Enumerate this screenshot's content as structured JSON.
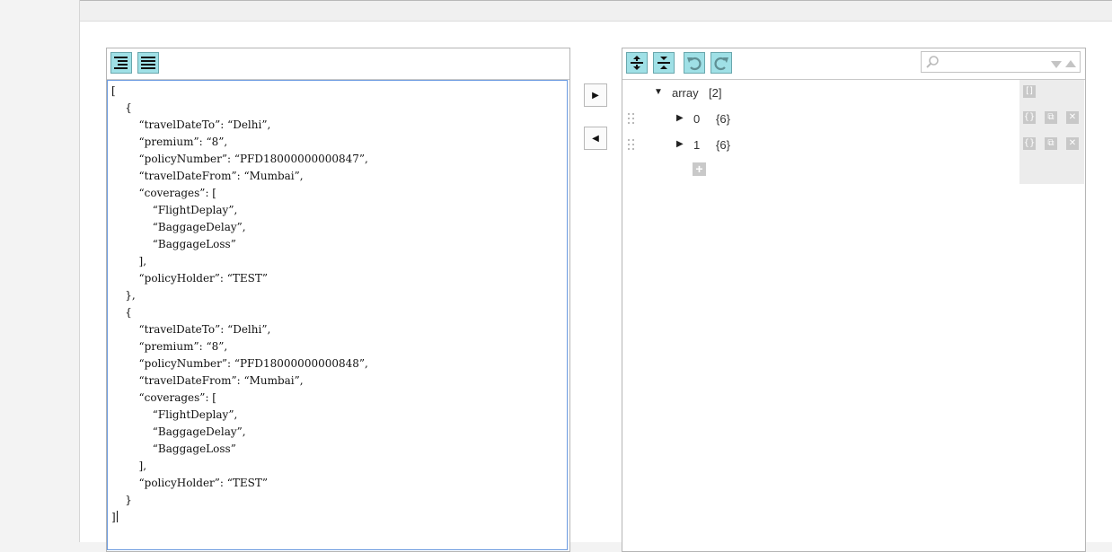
{
  "code_editor": {
    "format_button": "format-icon",
    "compact_button": "compact-icon",
    "lines": [
      "[",
      "    {",
      "        “travelDateTo”: “Delhi”,",
      "        “premium”: “8”,",
      "        “policyNumber”: “PFD18000000000847”,",
      "        “travelDateFrom”: “Mumbai”,",
      "        “coverages”: [",
      "            “FlightDeplay”,",
      "            “BaggageDelay”,",
      "            “BaggageLoss”",
      "        ],",
      "        “policyHolder”: “TEST”",
      "    },",
      "    {",
      "        “travelDateTo”: “Delhi”,",
      "        “premium”: “8”,",
      "        “policyNumber”: “PFD18000000000848”,",
      "        “travelDateFrom”: “Mumbai”,",
      "        “coverages”: [",
      "            “FlightDeplay”,",
      "            “BaggageDelay”,",
      "            “BaggageLoss”",
      "        ],",
      "        “policyHolder”: “TEST”",
      "    }",
      "]"
    ]
  },
  "transfer": {
    "to_tree_icon": "▶",
    "to_code_icon": "◀"
  },
  "tree_editor": {
    "search_placeholder": "",
    "root": {
      "key": "array",
      "count": "[2]",
      "type_badge": "[]"
    },
    "items": [
      {
        "index": "0",
        "count": "{6}"
      },
      {
        "index": "1",
        "count": "{6}"
      }
    ],
    "add_label": "+"
  },
  "colors": {
    "toolbar_button": "#9fe0e6",
    "editor_focus_border": "#6c9be0",
    "action_icon": "#c8c8c8"
  }
}
